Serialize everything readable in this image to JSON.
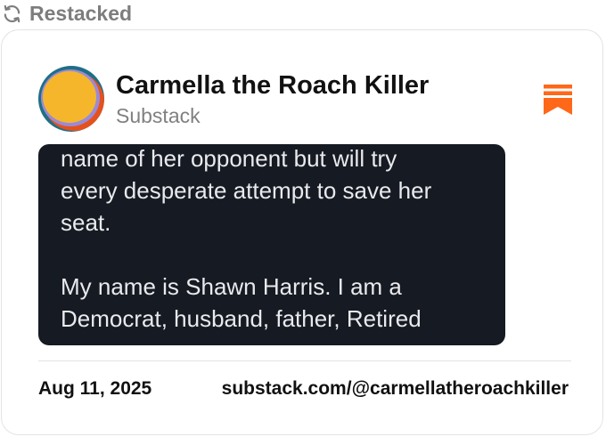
{
  "header": {
    "label": "Restacked",
    "icon": "refresh-icon",
    "color": "#7d7d7d"
  },
  "card": {
    "publication_name": "Carmella the Roach Killer",
    "publication_source": "Substack",
    "bookmark_icon": "substack-bookmark-icon",
    "accent": "#ff6719",
    "preview": {
      "lines": [
        "name of her opponent but will try",
        "every desperate attempt to save her",
        "seat.",
        "",
        "My name is Shawn Harris. I am a",
        "Democrat, husband, father, Retired"
      ]
    },
    "date": "Aug 11, 2025",
    "link": "substack.com/@carmellatheroachkiller"
  }
}
